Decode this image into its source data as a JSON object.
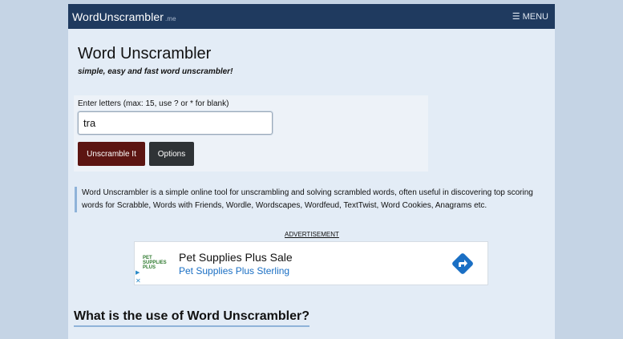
{
  "navbar": {
    "logo": "WordUnscrambler",
    "logo_tld": ".me",
    "menu_icon": "hamburger-icon",
    "menu_label": "MENU"
  },
  "header": {
    "title": "Word Unscrambler",
    "tagline": "simple, easy and fast word unscrambler!"
  },
  "form": {
    "label": "Enter letters (max: 15, use ? or * for blank)",
    "value": "tra",
    "unscramble_label": "Unscramble It",
    "options_label": "Options"
  },
  "intro": {
    "text": "Word Unscrambler is a simple online tool for unscrambling and solving scrambled words, often useful in discovering top scoring words for Scrabble, Words with Friends, Wordle, Wordscapes, Wordfeud, TextTwist, Word Cookies, Anagrams etc."
  },
  "ad": {
    "label": "ADVERTISEMENT",
    "logo_text": "PET SUPPLIES PLUS",
    "title": "Pet Supplies Plus Sale",
    "subtitle": "Pet Supplies Plus Sterling",
    "info_icon": "ad-info-icon",
    "close_icon": "close-icon",
    "arrow_icon": "directions-arrow-icon",
    "arrow_color": "#1a6fc4"
  },
  "section": {
    "heading": "What is the use of Word Unscrambler?"
  },
  "colors": {
    "navbar": "#1f3a5f",
    "unscramble_button": "#5c1512",
    "options_button": "#2f3336",
    "accent_border": "#8fb3d9"
  }
}
